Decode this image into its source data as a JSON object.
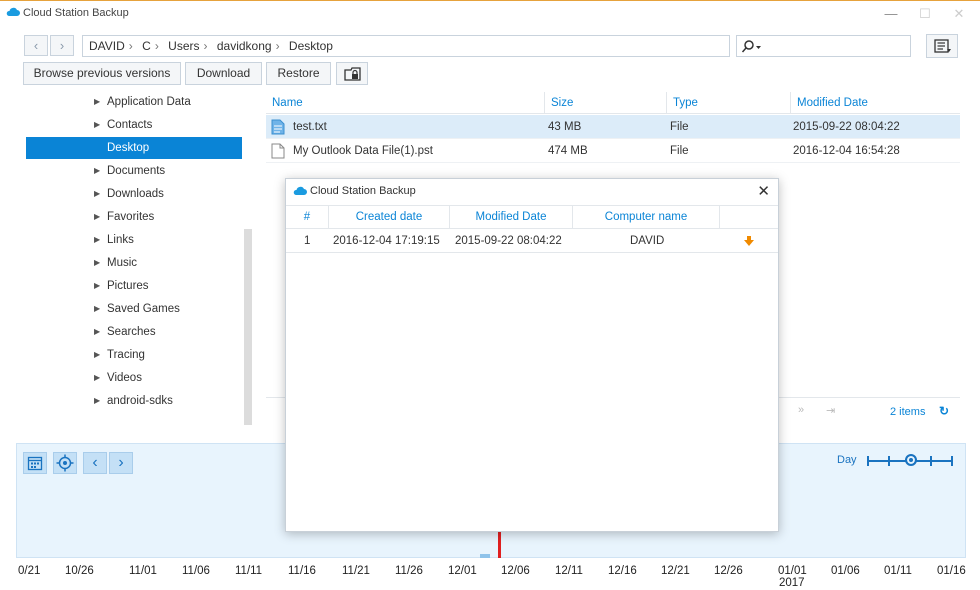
{
  "window": {
    "title": "Cloud Station Backup",
    "controls": [
      "—",
      "☐",
      "✕"
    ]
  },
  "path": [
    "DAVID",
    "C",
    "Users",
    "davidkong",
    "Desktop"
  ],
  "toolbar": {
    "browse": "Browse previous versions",
    "download": "Download",
    "restore": "Restore"
  },
  "tree": [
    "Application Data",
    "Contacts",
    "Desktop",
    "Documents",
    "Downloads",
    "Favorites",
    "Links",
    "Music",
    "Pictures",
    "Saved Games",
    "Searches",
    "Tracing",
    "Videos",
    "android-sdks"
  ],
  "files": {
    "columns": [
      "Name",
      "Size",
      "Type",
      "Modified Date"
    ],
    "rows": [
      {
        "name": "test.txt",
        "size": "43 MB",
        "type": "File",
        "modified": "2015-09-22 08:04:22"
      },
      {
        "name": "My Outlook Data File(1).pst",
        "size": "474 MB",
        "type": "File",
        "modified": "2016-12-04 16:54:28"
      }
    ],
    "count": "2 items"
  },
  "dialog": {
    "title": "Cloud Station Backup",
    "columns": [
      "#",
      "Created date",
      "Modified Date",
      "Computer name"
    ],
    "rows": [
      {
        "num": "1",
        "created": "2016-12-04 17:19:15",
        "modified": "2015-09-22 08:04:22",
        "computer": "DAVID"
      }
    ]
  },
  "timeline": {
    "zoom": "Day",
    "dates": [
      "0/21",
      "10/26",
      "11/01",
      "11/06",
      "11/11",
      "11/16",
      "11/21",
      "11/26",
      "12/01",
      "12/06",
      "12/11",
      "12/16",
      "12/21",
      "12/26",
      "01/01",
      "01/06",
      "01/11",
      "01/16"
    ],
    "year": "2017"
  },
  "colors": {
    "accent": "#0a84d6",
    "now_marker": "#e02020",
    "download_arrow": "#f08a00"
  }
}
